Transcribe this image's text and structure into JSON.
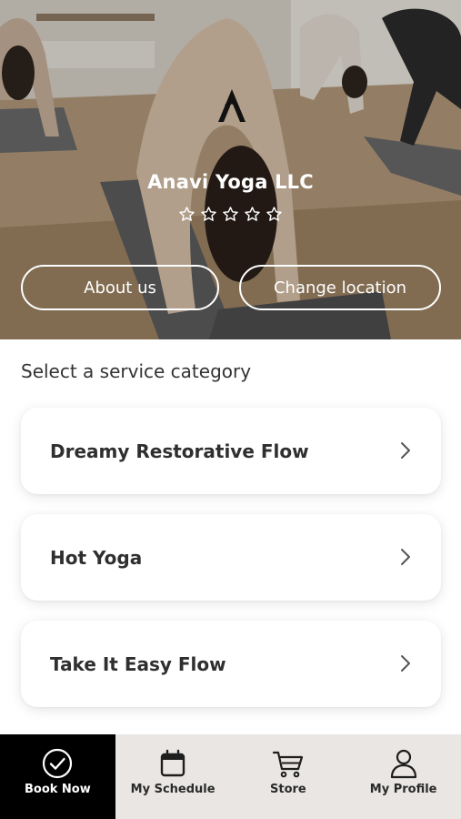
{
  "studio": {
    "name": "Anavi Yoga LLC",
    "rating": {
      "value": 0,
      "max": 5
    }
  },
  "hero_buttons": {
    "about_label": "About us",
    "location_label": "Change location"
  },
  "services": {
    "title": "Select a service category",
    "items": [
      {
        "label": "Dreamy Restorative Flow"
      },
      {
        "label": "Hot Yoga"
      },
      {
        "label": "Take It Easy Flow"
      }
    ]
  },
  "nav": {
    "items": [
      {
        "label": "Book Now",
        "icon": "check-circle-icon",
        "active": true
      },
      {
        "label": "My Schedule",
        "icon": "calendar-icon",
        "active": false
      },
      {
        "label": "Store",
        "icon": "cart-icon",
        "active": false
      },
      {
        "label": "My Profile",
        "icon": "person-icon",
        "active": false
      }
    ]
  },
  "colors": {
    "nav_background": "#e9e6e3",
    "nav_active_background": "#000000",
    "card_background": "#ffffff",
    "text_primary": "#2f2f2f"
  }
}
